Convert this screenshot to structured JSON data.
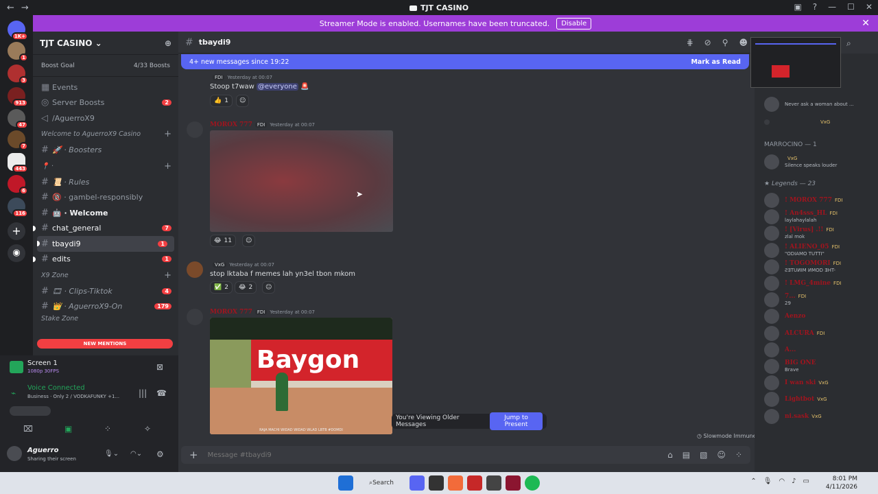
{
  "window": {
    "title": "TJT CASINO"
  },
  "banner": {
    "text": "Streamer Mode is enabled. Usernames have been truncated.",
    "button": "Disable"
  },
  "server": {
    "name": "TJT CASINO",
    "boost_label": "Boost Goal",
    "boost_count": "4/33 Boosts"
  },
  "server_badges": [
    "1K+",
    "1",
    "3",
    "913",
    "47",
    "7",
    "443",
    "6",
    "116"
  ],
  "channels": [
    {
      "type": "item",
      "label": "Events"
    },
    {
      "type": "item",
      "label": "Server Boosts",
      "badge": "2"
    },
    {
      "type": "channel",
      "label": "/AguerroX9",
      "icon": "speaker-icon"
    },
    {
      "type": "category",
      "label": "Welcome to AguerroX9 Casino"
    },
    {
      "type": "channel",
      "label": "🚀 · Boosters",
      "italic": true
    },
    {
      "type": "category",
      "label": "📍 ·"
    },
    {
      "type": "channel",
      "label": "📜 · Rules",
      "italic": true
    },
    {
      "type": "channel",
      "label": "🔞 · gambel-responsibly"
    },
    {
      "type": "channel",
      "label": "🤖 · Welcome",
      "bold": true
    },
    {
      "type": "channel",
      "label": "chat_general",
      "badge": "7",
      "unread": true
    },
    {
      "type": "channel",
      "label": "tbaydi9",
      "badge": "1",
      "active": true
    },
    {
      "type": "channel",
      "label": "edits",
      "badge": "1",
      "unread": true
    },
    {
      "type": "category",
      "label": "X9 Zone"
    },
    {
      "type": "channel",
      "label": "🎞 · Clips-Tiktok",
      "badge": "4",
      "italic": true
    },
    {
      "type": "channel",
      "label": "👑 · AguerroX9-On",
      "badge": "179",
      "italic": true
    }
  ],
  "new_mentions": "NEW MENTIONS",
  "stake_zone": "Stake Zone",
  "screen": {
    "title": "Screen 1",
    "sub": "1080p 30FPS"
  },
  "voice": {
    "status": "Voice Connected",
    "channel": "Business · Only 2 / VODKAFUNKY +1..."
  },
  "user": {
    "name": "Aguerro",
    "status": "Sharing their screen"
  },
  "chat": {
    "channel": "tbaydi9",
    "new_messages": "4+ new messages since 19:22",
    "mark_read": "Mark as Read",
    "messages": [
      {
        "name": "",
        "tag": "FDI",
        "time": "Yesterday at 00:07",
        "text": "Stoop t7waw ",
        "mention": "@everyone",
        "reactions": [
          {
            "emoji": "👍",
            "count": "1"
          }
        ]
      },
      {
        "name": "MOROX 777",
        "tag": "FDI",
        "time": "Yesterday at 00:07",
        "reactions": [
          {
            "emoji": "😂",
            "count": "11"
          }
        ]
      },
      {
        "name": "",
        "tag": "VxG",
        "time": "Yesterday at 00:07",
        "text": "stop lktaba f memes lah yn3el tbon mkom",
        "reactions": [
          {
            "emoji": "✅",
            "count": "2"
          },
          {
            "emoji": "😂",
            "count": "2"
          }
        ]
      },
      {
        "name": "MOROX 777",
        "tag": "FDI",
        "time": "Yesterday at 00:07",
        "image_text": "Baygon",
        "caption": "RAJA MACHI WIDAD WIDAD WLAD LBTB #DOMDI"
      }
    ],
    "older_text": "You're Viewing Older Messages",
    "jump": "Jump to Present",
    "slowmode": "Slowmode Immune",
    "input_placeholder": "Message #tbaydi9"
  },
  "members": {
    "top": [
      {
        "name": "",
        "sub": "Never ask a woman about ..."
      },
      {
        "name": "",
        "tag": "VxG"
      }
    ],
    "group1": "MARROCINO — 1",
    "group1_members": [
      {
        "name": "",
        "tag": "VxG",
        "sub": "Silence speaks louder"
      }
    ],
    "group2": "Legends — 23",
    "list": [
      {
        "name": "! MOROX 777",
        "tag": "FDI"
      },
      {
        "name": "! An4sss_HL",
        "tag": "FDI",
        "sub": "laylahaylalah"
      },
      {
        "name": "! [Virus] .!!",
        "tag": "FDI",
        "sub": "zlal mok"
      },
      {
        "name": "! ALIENO_05",
        "tag": "FDI",
        "sub": "\"ODIAMO TUTTI\""
      },
      {
        "name": "! TOGOMORI",
        "tag": "FDI",
        "sub": "ƧƎTUИIM ИMOD ƎHT-"
      },
      {
        "name": "! LMG_4mine",
        "tag": "FDI"
      },
      {
        "name": "7...",
        "tag": "FDI",
        "sub": "29"
      },
      {
        "name": "Aenzo"
      },
      {
        "name": "ALCURA",
        "tag": "FDI"
      },
      {
        "name": "A..."
      },
      {
        "name": "BIG ONE",
        "sub": "Brave"
      },
      {
        "name": "I wan ski",
        "tag": "VxG"
      },
      {
        "name": "Lightbot",
        "tag": "VxG"
      },
      {
        "name": "ni.sask",
        "tag": "VxG"
      }
    ]
  },
  "taskbar": {
    "search": "Search",
    "time": "8:01 PM",
    "date": "4/11/2026"
  }
}
